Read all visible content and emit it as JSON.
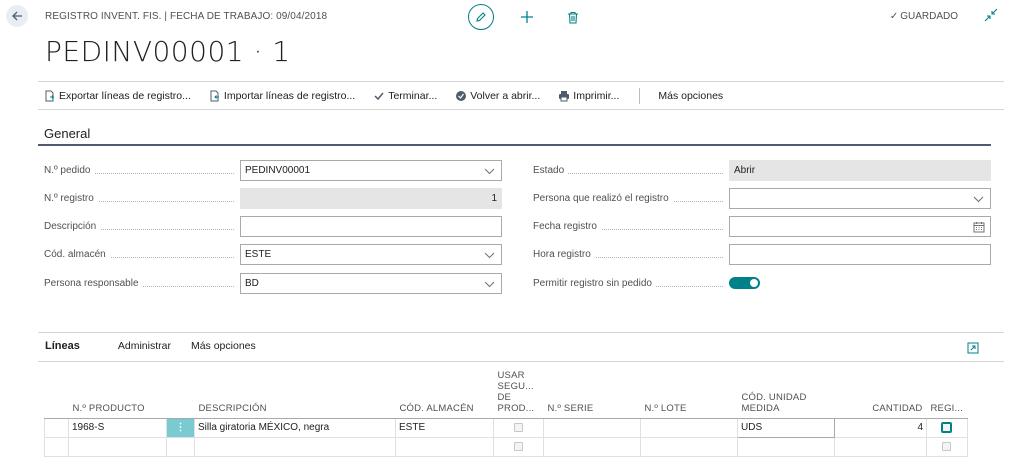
{
  "header": {
    "context_title": "REGISTRO INVENT. FIS. | FECHA DE TRABAJO: 09/04/2018",
    "record_title": "PEDINV00001 · 1",
    "saved_status": "GUARDADO"
  },
  "actions": {
    "export": "Exportar líneas de registro...",
    "import": "Importar líneas de registro...",
    "finish": "Terminar...",
    "reopen": "Volver a abrir...",
    "print": "Imprimir...",
    "more": "Más opciones"
  },
  "general": {
    "title": "General",
    "order_no_label": "N.º pedido",
    "order_no_value": "PEDINV00001",
    "recording_no_label": "N.º registro",
    "recording_no_value": "1",
    "description_label": "Descripción",
    "description_value": "",
    "location_label": "Cód. almacén",
    "location_value": "ESTE",
    "responsible_label": "Persona responsable",
    "responsible_value": "BD",
    "status_label": "Estado",
    "status_value": "Abrir",
    "person_recorded_label": "Persona que realizó el registro",
    "person_recorded_value": "",
    "date_label": "Fecha registro",
    "date_value": "",
    "time_label": "Hora registro",
    "time_value": "",
    "allow_label": "Permitir registro sin pedido",
    "allow_value": true
  },
  "lines": {
    "title": "Líneas",
    "manage": "Administrar",
    "more": "Más opciones",
    "columns": {
      "item_no": "N.º PRODUCTO",
      "description": "DESCRIPCIÓN",
      "location": "CÓD. ALMACÉN",
      "use_tracking_1": "USAR",
      "use_tracking_2": "SEGU...",
      "use_tracking_3": "DE",
      "use_tracking_4": "PROD...",
      "serial": "N.º SERIE",
      "lot": "N.º LOTE",
      "uom_1": "CÓD. UNIDAD",
      "uom_2": "MEDIDA",
      "quantity": "CANTIDAD",
      "recorded": "REGI..."
    },
    "rows": [
      {
        "item_no": "1968-S",
        "menu": "⋮",
        "description": "Silla giratoria MÉXICO, negra",
        "location": "ESTE",
        "serial": "",
        "lot": "",
        "uom": "UDS",
        "quantity": "4"
      },
      {
        "item_no": "",
        "menu": "",
        "description": "",
        "location": "",
        "serial": "",
        "lot": "",
        "uom": "",
        "quantity": ""
      }
    ]
  },
  "colors": {
    "accent": "#00818a",
    "accent_light": "#79cbd1",
    "section_line": "#505c6d"
  },
  "icons": {
    "back": "back-arrow-icon",
    "edit": "pencil-icon",
    "new": "plus-icon",
    "delete": "trash-icon",
    "collapse": "collapse-arrows-icon",
    "export": "export-file-icon",
    "import": "import-file-icon",
    "finish": "checkmark-icon",
    "reopen": "reopen-icon",
    "print": "printer-icon",
    "expand": "expand-pane-icon",
    "calendar": "calendar-icon"
  }
}
